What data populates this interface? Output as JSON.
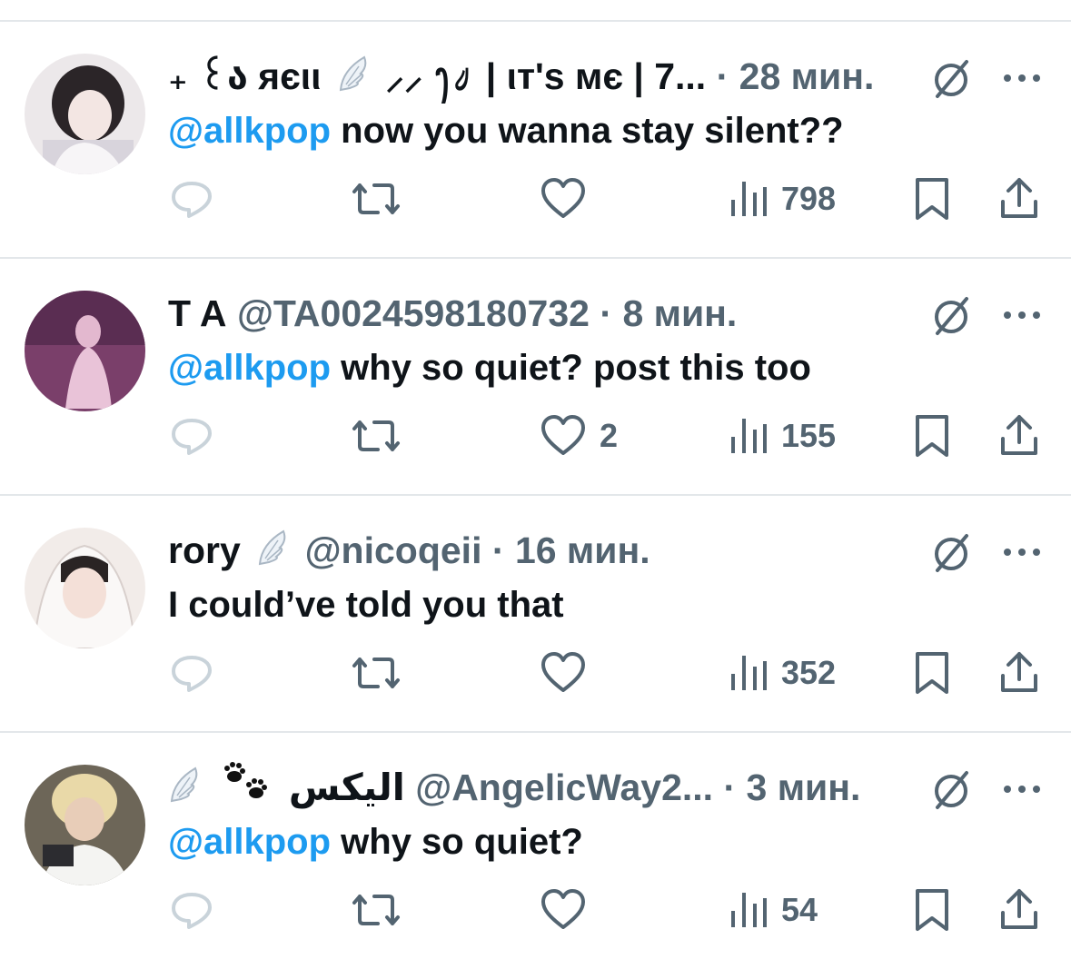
{
  "tweets": [
    {
      "name": "₊ ꒰ა яєιι",
      "name_extra": "⸝⸝ ꫂ᭣  | ιт'ѕ мє | 7...",
      "handle": "",
      "dot": "·",
      "time": "28 мин.",
      "mention": "@allkpop",
      "text": " now you wanna stay silent??",
      "likes": "",
      "views": "798",
      "avatar_color": "#e9e4e6"
    },
    {
      "name": "T A",
      "name_extra": "",
      "handle": "@TA0024598180732",
      "dot": "·",
      "time": "8 мин.",
      "mention": "@allkpop",
      "text": " why so quiet? post this too",
      "likes": "2",
      "views": "155",
      "avatar_color": "#8a4f7a"
    },
    {
      "name": "rory",
      "name_extra": "",
      "handle": "@nicoqeii",
      "dot": "·",
      "time": "16 мин.",
      "mention": "",
      "text": "I could’ve told you that",
      "likes": "",
      "views": "352",
      "avatar_color": "#e8dfdb"
    },
    {
      "name": "اليكس",
      "name_extra": "",
      "handle": "@AngelicWay2...",
      "dot": "·",
      "time": "3 мин.",
      "mention": "@allkpop",
      "text": " why so quiet?",
      "likes": "",
      "views": "54",
      "avatar_color": "#8c8273"
    }
  ],
  "colors": {
    "accent": "#1d9bf0",
    "secondary_text": "#536471",
    "primary_text": "#0f1419",
    "divider": "#e3e7ea",
    "reply_icon": "#c9d3da"
  }
}
